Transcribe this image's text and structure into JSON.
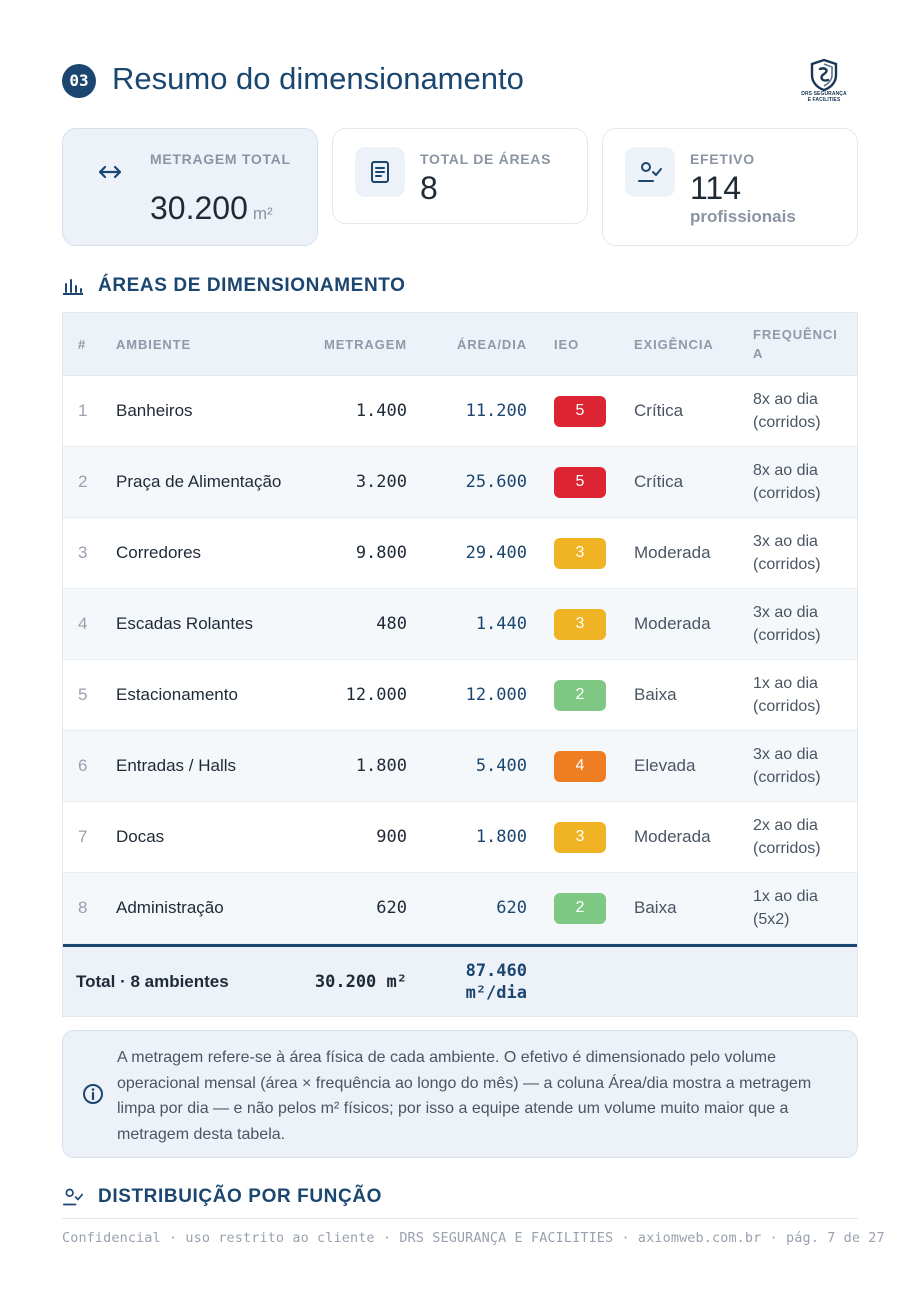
{
  "header": {
    "section_number": "03",
    "title": "Resumo do dimensionamento",
    "logo": {
      "line1": "DRS SEGURANÇA",
      "line2": "E FACILITIES"
    }
  },
  "cards": [
    {
      "label": "METRAGEM TOTAL",
      "value": "30.200",
      "unit": "m²",
      "icon": "arrows-horizontal-icon"
    },
    {
      "label": "TOTAL DE ÁREAS",
      "value": "8",
      "icon": "document-icon"
    },
    {
      "label": "EFETIVO",
      "value": "114",
      "sub": "profissionais",
      "icon": "user-check-icon"
    }
  ],
  "areas_section": {
    "title": "ÁREAS DE DIMENSIONAMENTO",
    "icon": "bar-chart-icon"
  },
  "table": {
    "headers": {
      "n": "#",
      "ambiente": "AMBIENTE",
      "metragem": "METRAGEM",
      "area_dia": "ÁREA/DIA",
      "ieo": "IEO",
      "exigencia": "EXIGÊNCIA",
      "frequencia": "FREQUÊNCIA"
    },
    "rows": [
      {
        "n": "1",
        "ambiente": "Banheiros",
        "metragem": "1.400",
        "area_dia": "11.200",
        "ieo": "5",
        "ieo_color": "#dc2433",
        "exigencia": "Crítica",
        "frequencia": "8x ao dia (corridos)"
      },
      {
        "n": "2",
        "ambiente": "Praça de Alimentação",
        "metragem": "3.200",
        "area_dia": "25.600",
        "ieo": "5",
        "ieo_color": "#dc2433",
        "exigencia": "Crítica",
        "frequencia": "8x ao dia (corridos)"
      },
      {
        "n": "3",
        "ambiente": "Corredores",
        "metragem": "9.800",
        "area_dia": "29.400",
        "ieo": "3",
        "ieo_color": "#f0b323",
        "exigencia": "Moderada",
        "frequencia": "3x ao dia (corridos)"
      },
      {
        "n": "4",
        "ambiente": "Escadas Rolantes",
        "metragem": "480",
        "area_dia": "1.440",
        "ieo": "3",
        "ieo_color": "#f0b323",
        "exigencia": "Moderada",
        "frequencia": "3x ao dia (corridos)"
      },
      {
        "n": "5",
        "ambiente": "Estacionamento",
        "metragem": "12.000",
        "area_dia": "12.000",
        "ieo": "2",
        "ieo_color": "#7fc883",
        "exigencia": "Baixa",
        "frequencia": "1x ao dia (corridos)"
      },
      {
        "n": "6",
        "ambiente": "Entradas / Halls",
        "metragem": "1.800",
        "area_dia": "5.400",
        "ieo": "4",
        "ieo_color": "#ef7d22",
        "exigencia": "Elevada",
        "frequencia": "3x ao dia (corridos)"
      },
      {
        "n": "7",
        "ambiente": "Docas",
        "metragem": "900",
        "area_dia": "1.800",
        "ieo": "3",
        "ieo_color": "#f0b323",
        "exigencia": "Moderada",
        "frequencia": "2x ao dia (corridos)"
      },
      {
        "n": "8",
        "ambiente": "Administração",
        "metragem": "620",
        "area_dia": "620",
        "ieo": "2",
        "ieo_color": "#7fc883",
        "exigencia": "Baixa",
        "frequencia": "1x ao dia (5x2)"
      }
    ],
    "total": {
      "label": "Total · 8 ambientes",
      "metragem": "30.200 m²",
      "area_dia": "87.460 m²/dia"
    }
  },
  "note": {
    "icon": "info-icon",
    "text": "A metragem refere-se à área física de cada ambiente. O efetivo é dimensionado pelo volume operacional mensal (área × frequência ao longo do mês) — a coluna Área/dia mostra a metragem limpa por dia — e não pelos m² físicos; por isso a equipe atende um volume muito maior que a metragem desta tabela."
  },
  "distribution_section": {
    "title": "DISTRIBUIÇÃO POR FUNÇÃO",
    "icon": "user-check-icon"
  },
  "footer": {
    "text": "Confidencial · uso restrito ao cliente · DRS SEGURANÇA E FACILITIES · axiomweb.com.br · pág. 7 de 27"
  },
  "colors": {
    "primary": "#1b4670",
    "card_bg": "#edf2f9",
    "muted": "#8a94a3"
  }
}
